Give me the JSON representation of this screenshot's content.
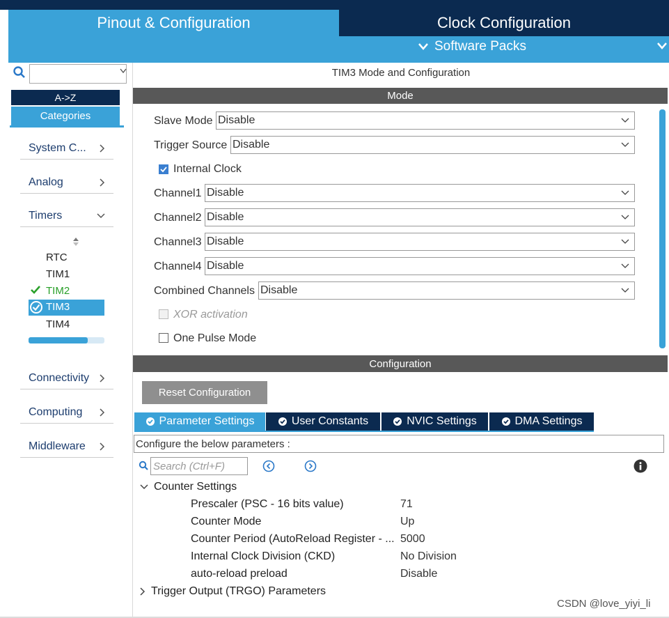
{
  "header": {
    "tab_pinout": "Pinout & Configuration",
    "tab_clock": "Clock Configuration",
    "software_packs": "Software Packs"
  },
  "sidebar": {
    "search_value": "",
    "az": "A->Z",
    "categories": "Categories",
    "items": [
      {
        "label": "System C..."
      },
      {
        "label": "Analog"
      },
      {
        "label": "Timers"
      },
      {
        "label": "Connectivity"
      },
      {
        "label": "Computing"
      },
      {
        "label": "Middleware"
      }
    ],
    "timers": [
      "RTC",
      "TIM1",
      "TIM2",
      "TIM3",
      "TIM4"
    ],
    "selected_timer": "TIM3"
  },
  "panel": {
    "title": "TIM3 Mode and Configuration",
    "mode_header": "Mode",
    "config_header": "Configuration"
  },
  "mode": {
    "slave_mode_label": "Slave Mode",
    "slave_mode_value": "Disable",
    "trigger_source_label": "Trigger Source",
    "trigger_source_value": "Disable",
    "internal_clock_label": "Internal Clock",
    "internal_clock_checked": true,
    "channel1_label": "Channel1",
    "channel1_value": "Disable",
    "channel2_label": "Channel2",
    "channel2_value": "Disable",
    "channel3_label": "Channel3",
    "channel3_value": "Disable",
    "channel4_label": "Channel4",
    "channel4_value": "Disable",
    "combined_label": "Combined Channels",
    "combined_value": "Disable",
    "xor_label": "XOR activation",
    "one_pulse_label": "One Pulse Mode"
  },
  "config": {
    "reset_button": "Reset Configuration",
    "tabs": [
      {
        "label": "Parameter Settings"
      },
      {
        "label": "User Constants"
      },
      {
        "label": "NVIC Settings"
      },
      {
        "label": "DMA Settings"
      }
    ],
    "configure_text": "Configure the below parameters :",
    "search_placeholder": "Search (Ctrl+F)",
    "counter_settings": "Counter Settings",
    "params": [
      {
        "name": "Prescaler (PSC - 16 bits value)",
        "value": "71"
      },
      {
        "name": "Counter Mode",
        "value": "Up"
      },
      {
        "name": "Counter Period (AutoReload Register - ...",
        "value": "5000"
      },
      {
        "name": "Internal Clock Division (CKD)",
        "value": "No Division"
      },
      {
        "name": "auto-reload preload",
        "value": "Disable"
      }
    ],
    "trigger_output": "Trigger Output (TRGO) Parameters"
  },
  "watermark": "CSDN @love_yiyi_li",
  "colors": {
    "accent_blue": "#3aa2d8",
    "navy": "#0b2a50",
    "header_gray": "#585858",
    "check_green": "#2aa02a"
  }
}
